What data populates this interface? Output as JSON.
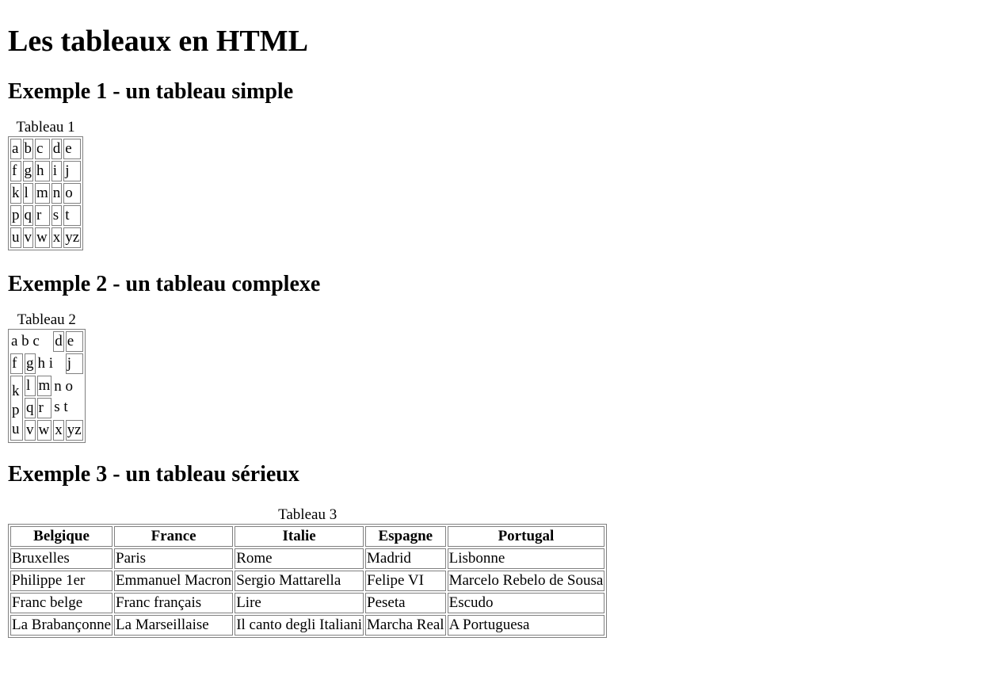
{
  "title": "Les tableaux en HTML",
  "example1": {
    "heading": "Exemple 1 - un tableau simple",
    "caption": "Tableau 1",
    "rows": [
      [
        "a",
        "b",
        "c",
        "d",
        "e"
      ],
      [
        "f",
        "g",
        "h",
        "i",
        "j"
      ],
      [
        "k",
        "l",
        "m",
        "n",
        "o"
      ],
      [
        "p",
        "q",
        "r",
        "s",
        "t"
      ],
      [
        "u",
        "v",
        "w",
        "x",
        "yz"
      ]
    ]
  },
  "example2": {
    "heading": "Exemple 2 - un tableau complexe",
    "caption": "Tableau 2",
    "cells": {
      "abc": "a b c",
      "d": "d",
      "e": "e",
      "f": "f",
      "g": "g",
      "hi": "h i",
      "j": "j",
      "kpu": "k p u",
      "l": "l",
      "m": "m",
      "no_st": "n o s t",
      "q": "q",
      "r": "r",
      "v": "v",
      "w": "w",
      "x": "x",
      "yz": "yz"
    }
  },
  "example3": {
    "heading": "Exemple 3 - un tableau sérieux",
    "caption": "Tableau 3",
    "headers": [
      "Belgique",
      "France",
      "Italie",
      "Espagne",
      "Portugal"
    ],
    "rows": [
      [
        "Bruxelles",
        "Paris",
        "Rome",
        "Madrid",
        "Lisbonne"
      ],
      [
        "Philippe 1er",
        "Emmanuel Macron",
        "Sergio Mattarella",
        "Felipe VI",
        "Marcelo Rebelo de Sousa"
      ],
      [
        "Franc belge",
        "Franc français",
        "Lire",
        "Peseta",
        "Escudo"
      ],
      [
        "La Brabançonne",
        "La Marseillaise",
        "Il canto degli Italiani",
        "Marcha Real",
        "A Portuguesa"
      ]
    ]
  }
}
